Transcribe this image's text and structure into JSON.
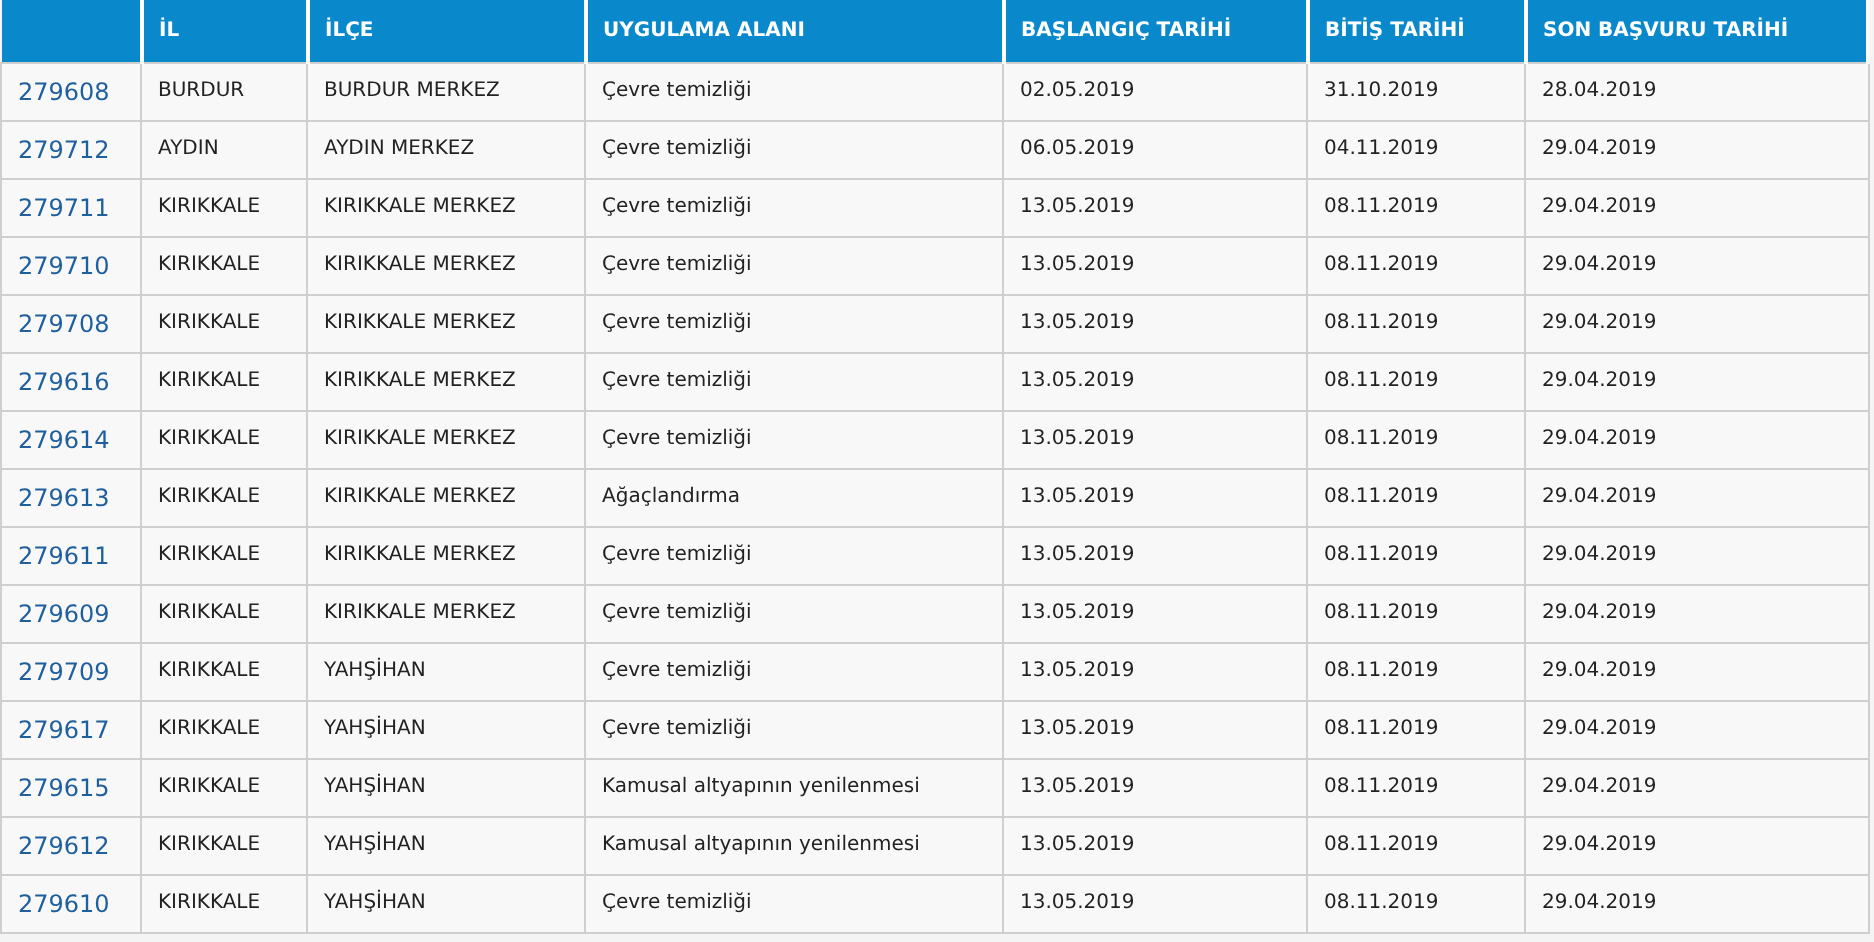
{
  "table": {
    "columns": [
      "İL",
      "İLÇE",
      "UYGULAMA ALANI",
      "BAŞLANGIÇ TARİHİ",
      "BİTİŞ TARİHİ",
      "SON BAŞVURU TARİHİ"
    ],
    "rows": [
      {
        "id": "279608",
        "cells": [
          "BURDUR",
          "BURDUR MERKEZ",
          "Çevre temizliği",
          "02.05.2019",
          "31.10.2019",
          "28.04.2019"
        ]
      },
      {
        "id": "279712",
        "cells": [
          "AYDIN",
          "AYDIN MERKEZ",
          "Çevre temizliği",
          "06.05.2019",
          "04.11.2019",
          "29.04.2019"
        ]
      },
      {
        "id": "279711",
        "cells": [
          "KIRIKKALE",
          "KIRIKKALE MERKEZ",
          "Çevre temizliği",
          "13.05.2019",
          "08.11.2019",
          "29.04.2019"
        ]
      },
      {
        "id": "279710",
        "cells": [
          "KIRIKKALE",
          "KIRIKKALE MERKEZ",
          "Çevre temizliği",
          "13.05.2019",
          "08.11.2019",
          "29.04.2019"
        ]
      },
      {
        "id": "279708",
        "cells": [
          "KIRIKKALE",
          "KIRIKKALE MERKEZ",
          "Çevre temizliği",
          "13.05.2019",
          "08.11.2019",
          "29.04.2019"
        ]
      },
      {
        "id": "279616",
        "cells": [
          "KIRIKKALE",
          "KIRIKKALE MERKEZ",
          "Çevre temizliği",
          "13.05.2019",
          "08.11.2019",
          "29.04.2019"
        ]
      },
      {
        "id": "279614",
        "cells": [
          "KIRIKKALE",
          "KIRIKKALE MERKEZ",
          "Çevre temizliği",
          "13.05.2019",
          "08.11.2019",
          "29.04.2019"
        ]
      },
      {
        "id": "279613",
        "cells": [
          "KIRIKKALE",
          "KIRIKKALE MERKEZ",
          "Ağaçlandırma",
          "13.05.2019",
          "08.11.2019",
          "29.04.2019"
        ]
      },
      {
        "id": "279611",
        "cells": [
          "KIRIKKALE",
          "KIRIKKALE MERKEZ",
          "Çevre temizliği",
          "13.05.2019",
          "08.11.2019",
          "29.04.2019"
        ]
      },
      {
        "id": "279609",
        "cells": [
          "KIRIKKALE",
          "KIRIKKALE MERKEZ",
          "Çevre temizliği",
          "13.05.2019",
          "08.11.2019",
          "29.04.2019"
        ]
      },
      {
        "id": "279709",
        "cells": [
          "KIRIKKALE",
          "YAHŞİHAN",
          "Çevre temizliği",
          "13.05.2019",
          "08.11.2019",
          "29.04.2019"
        ]
      },
      {
        "id": "279617",
        "cells": [
          "KIRIKKALE",
          "YAHŞİHAN",
          "Çevre temizliği",
          "13.05.2019",
          "08.11.2019",
          "29.04.2019"
        ]
      },
      {
        "id": "279615",
        "cells": [
          "KIRIKKALE",
          "YAHŞİHAN",
          "Kamusal altyapının yenilenmesi",
          "13.05.2019",
          "08.11.2019",
          "29.04.2019"
        ]
      },
      {
        "id": "279612",
        "cells": [
          "KIRIKKALE",
          "YAHŞİHAN",
          "Kamusal altyapının yenilenmesi",
          "13.05.2019",
          "08.11.2019",
          "29.04.2019"
        ]
      },
      {
        "id": "279610",
        "cells": [
          "KIRIKKALE",
          "YAHŞİHAN",
          "Çevre temizliği",
          "13.05.2019",
          "08.11.2019",
          "29.04.2019"
        ]
      }
    ]
  }
}
